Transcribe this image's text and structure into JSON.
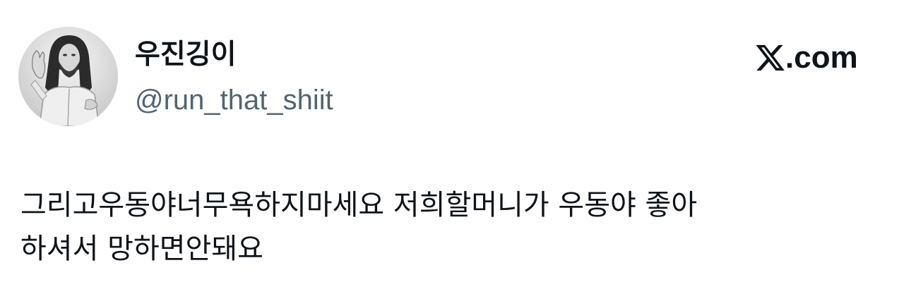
{
  "author": {
    "display_name": "우진깅이",
    "handle": "@run_that_shiit",
    "avatar_icon": "avatar-portrait-icon"
  },
  "brand": {
    "logo_icon": "x-logo-icon",
    "text": ".com"
  },
  "tweet": {
    "lines": [
      "그리고우동야너무욕하지마세요 저희할머니가 우동야 좋아",
      "하셔서 망하면안돼요"
    ]
  },
  "colors": {
    "text_primary": "#0f1419",
    "text_secondary": "#536471",
    "background": "#ffffff"
  }
}
